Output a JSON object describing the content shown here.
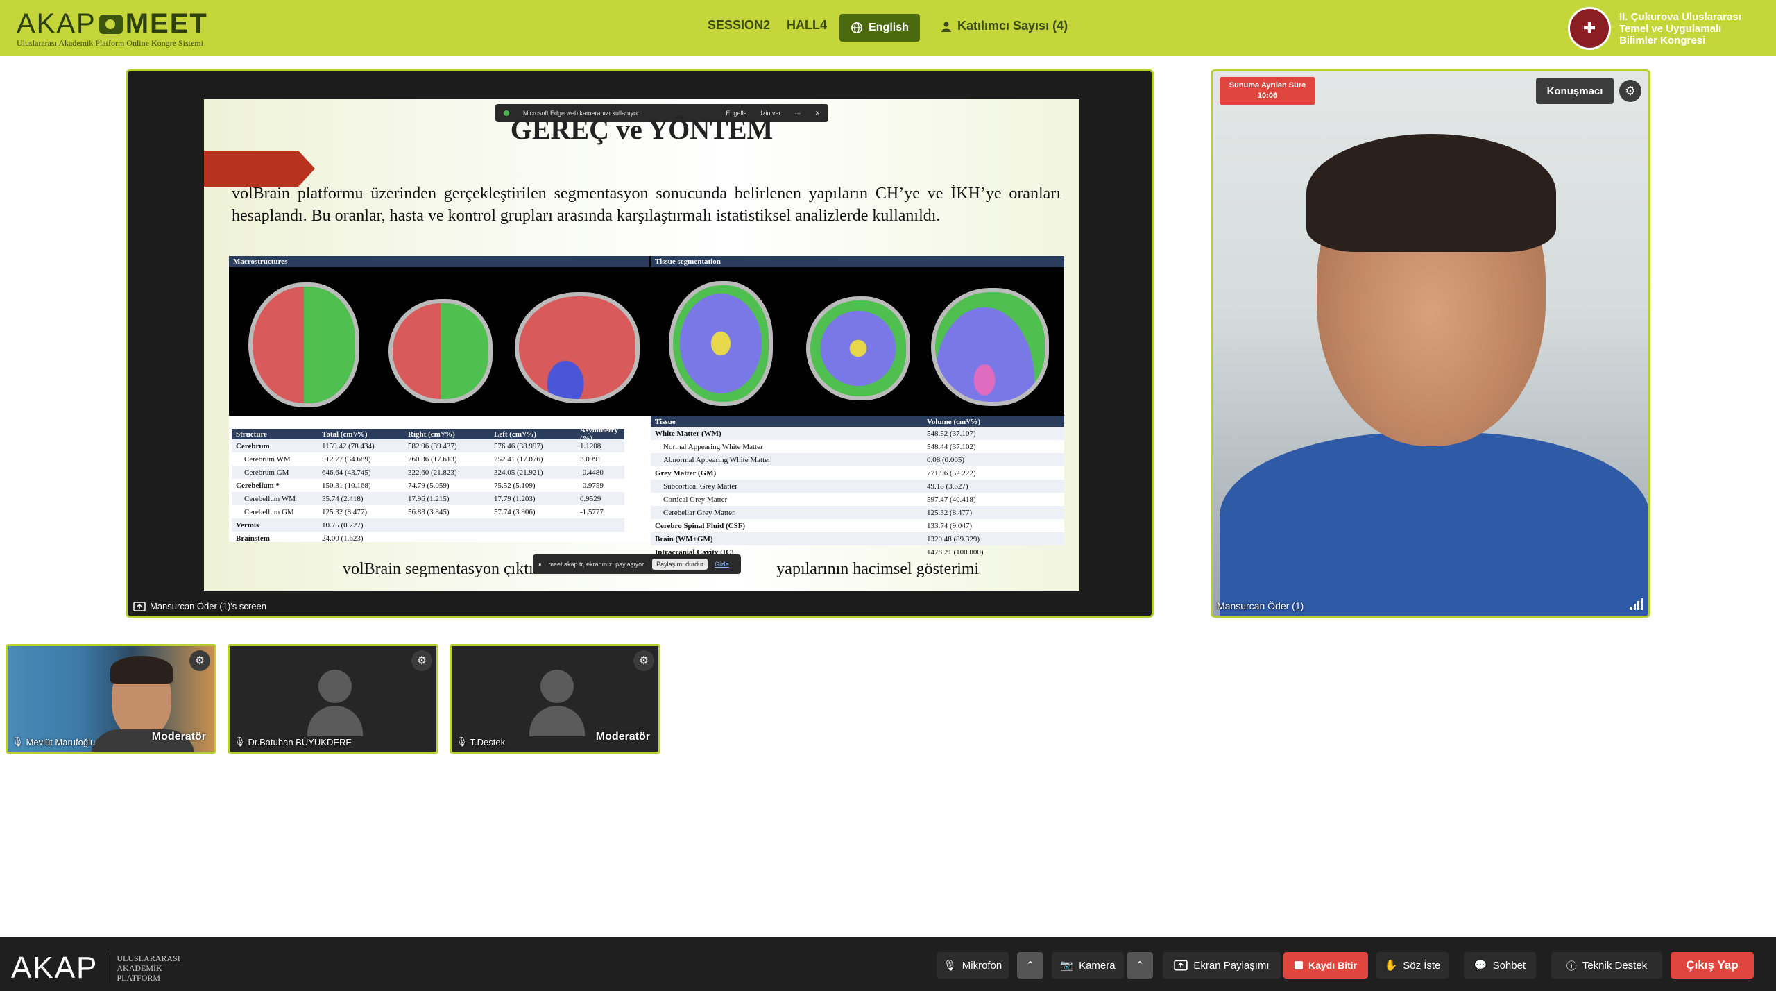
{
  "header": {
    "logo_left": "AKAP",
    "logo_right": "MEET",
    "logo_subtitle": "Uluslararası Akademik Platform Online Kongre Sistemi",
    "session": "SESSION2",
    "hall": "HALL4",
    "language_button": "English",
    "participants": "Katılımcı Sayısı (4)",
    "congress_line1": "II. Çukurova Uluslararası",
    "congress_line2": "Temel ve Uygulamalı",
    "congress_line3": "Bilimler Kongresi"
  },
  "edge_notice": {
    "text": "Microsoft Edge web kameranızı kullanıyor",
    "block": "Engelle",
    "allow": "İzin ver"
  },
  "slide": {
    "title": "GEREÇ ve YÖNTEM",
    "body": "volBrain platformu üzerinden gerçekleştirilen segmentasyon sonucunda belirlenen yapıların CH’ye ve İKH’ye oranları hesaplandı. Bu oranlar, hasta ve kontrol grupları arasında karşılaştırmalı istatistiksel analizlerde kullanıldı.",
    "fig_macro": "Macrostructures",
    "fig_tissue": "Tissue segmentation",
    "left_table": {
      "headers": [
        "Structure",
        "Total (cm³/%)",
        "Right (cm³/%)",
        "Left (cm³/%)",
        "Asymmetry (%)"
      ],
      "rows": [
        [
          "Cerebrum",
          "1159.42 (78.434)",
          "582.96 (39.437)",
          "576.46 (38.997)",
          "1.1208"
        ],
        [
          "Cerebrum WM",
          "512.77 (34.689)",
          "260.36 (17.613)",
          "252.41 (17.076)",
          "3.0991"
        ],
        [
          "Cerebrum GM",
          "646.64 (43.745)",
          "322.60 (21.823)",
          "324.05 (21.921)",
          "-0.4480"
        ],
        [
          "Cerebellum *",
          "150.31 (10.168)",
          "74.79 (5.059)",
          "75.52 (5.109)",
          "-0.9759"
        ],
        [
          "Cerebellum WM",
          "35.74 (2.418)",
          "17.96 (1.215)",
          "17.79 (1.203)",
          "0.9529"
        ],
        [
          "Cerebellum GM",
          "125.32 (8.477)",
          "56.83 (3.845)",
          "57.74 (3.906)",
          "-1.5777"
        ],
        [
          "Vermis",
          "10.75 (0.727)",
          "",
          "",
          ""
        ],
        [
          "Brainstem",
          "24.00 (1.623)",
          "",
          "",
          ""
        ]
      ]
    },
    "right_table": {
      "headers": [
        "Tissue",
        "Volume (cm³/%)"
      ],
      "rows": [
        [
          "White Matter (WM)",
          "548.52 (37.107)"
        ],
        [
          "Normal Appearing White Matter",
          "548.44 (37.102)"
        ],
        [
          "Abnormal Appearing White Matter",
          "0.08 (0.005)"
        ],
        [
          "Grey Matter (GM)",
          "771.96 (52.222)"
        ],
        [
          "Subcortical Grey Matter",
          "49.18 (3.327)"
        ],
        [
          "Cortical Grey Matter",
          "597.47 (40.418)"
        ],
        [
          "Cerebellar Grey Matter",
          "125.32 (8.477)"
        ],
        [
          "Cerebro Spinal Fluid (CSF)",
          "133.74 (9.047)"
        ],
        [
          "Brain (WM+GM)",
          "1320.48 (89.329)"
        ],
        [
          "Intracranial Cavity (IC)",
          "1478.21 (100.000)"
        ]
      ]
    },
    "caption_left": "volBrain segmentasyon çıktıl",
    "caption_right": "yapılarının hacimsel gösterimi"
  },
  "share_bar": {
    "text": "meet.akap.tr, ekranınızı paylaşıyor.",
    "stop": "Paylaşımı durdur",
    "hide": "Gizle"
  },
  "screen_label": "Mansurcan Öder (1)'s screen",
  "speaker": {
    "timer_label": "Sunuma Ayrılan Süre",
    "timer_value": "10:06",
    "badge": "Konuşmacı",
    "name": "Mansurcan Öder (1)"
  },
  "thumbnails": [
    {
      "name": "Mevlüt Marufoğlu",
      "role": "Moderatör"
    },
    {
      "name": "Dr.Batuhan BÜYÜKDERE",
      "role": ""
    },
    {
      "name": "T.Destek",
      "role": "Moderatör"
    }
  ],
  "footer": {
    "logo": "AKAP",
    "logo_line1": "ULUSLARARASI",
    "logo_line2": "AKADEMİK",
    "logo_line3": "PLATFORM",
    "mic": "Mikrofon",
    "camera": "Kamera",
    "screen_share": "Ekran Paylaşımı",
    "record": "Kaydı Bitir",
    "raise_hand": "Söz İste",
    "chat": "Sohbet",
    "support": "Teknik Destek",
    "exit": "Çıkış Yap"
  },
  "colors": {
    "accent": "#c4d63a",
    "frame": "#b9cf2d",
    "dark_button": "#4b6a10",
    "danger": "#e0453e"
  }
}
